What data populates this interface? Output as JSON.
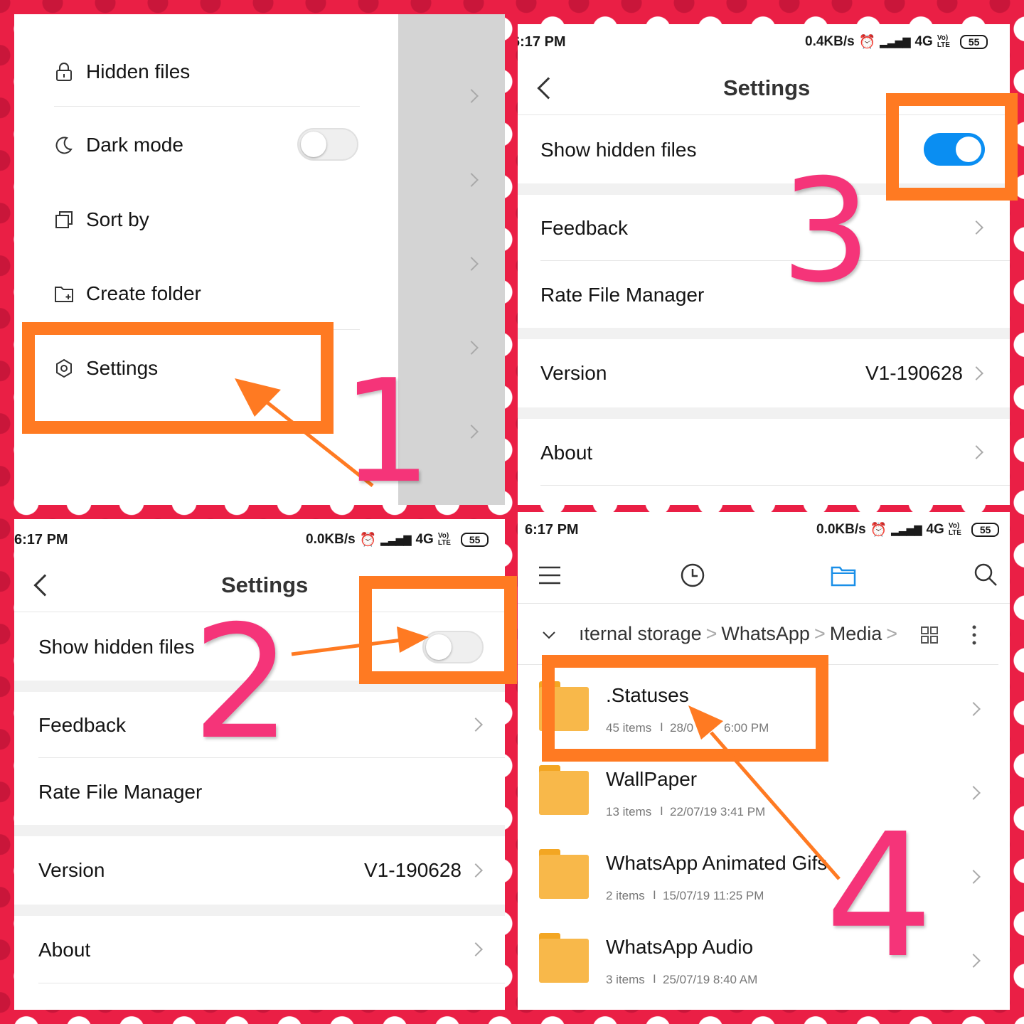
{
  "panel1": {
    "menu": [
      {
        "icon": "lock-icon",
        "label": "Hidden files"
      },
      {
        "icon": "moon-icon",
        "label": "Dark mode"
      },
      {
        "icon": "copy-icon",
        "label": "Sort by"
      },
      {
        "icon": "folder-plus-icon",
        "label": "Create folder"
      },
      {
        "icon": "gear-icon",
        "label": "Settings"
      }
    ],
    "dark_mode_enabled": false,
    "step": "1"
  },
  "panel2": {
    "status": {
      "time": "6:17 PM",
      "speed": "0.0KB/s",
      "network": "4G",
      "volte": "Vo) LTE",
      "battery": "55"
    },
    "title": "Settings",
    "show_hidden_label": "Show hidden files",
    "show_hidden_enabled": false,
    "feedback": "Feedback",
    "rate": "Rate File Manager",
    "version_label": "Version",
    "version_value": "V1-190628",
    "about": "About",
    "step": "2"
  },
  "panel3": {
    "status": {
      "time": "6:17 PM",
      "speed": "0.4KB/s",
      "network": "4G",
      "volte": "Vo) LTE",
      "battery": "55"
    },
    "title": "Settings",
    "show_hidden_label": "Show hidden files",
    "show_hidden_enabled": true,
    "feedback": "Feedback",
    "rate": "Rate File Manager",
    "version_label": "Version",
    "version_value": "V1-190628",
    "about": "About",
    "step": "3"
  },
  "panel4": {
    "status": {
      "time": "6:17 PM",
      "speed": "0.0KB/s",
      "network": "4G",
      "volte": "Vo) LTE",
      "battery": "55"
    },
    "breadcrumb": [
      "ıternal storage",
      "WhatsApp",
      "Media"
    ],
    "folders": [
      {
        "name": ".Statuses",
        "items": "45 items",
        "date": "28/0",
        "time": "6:00 PM"
      },
      {
        "name": "WallPaper",
        "items": "13 items",
        "date": "22/07/19 3:41 PM"
      },
      {
        "name": "WhatsApp Animated Gifs",
        "items": "2 items",
        "date": "15/07/19 11:25 PM"
      },
      {
        "name": "WhatsApp Audio",
        "items": "3 items",
        "date": "25/07/19 8:40 AM"
      }
    ],
    "meta_separator": "I",
    "step": "4"
  },
  "colors": {
    "highlight": "#ff7a22",
    "step_number": "#f53479",
    "toggle_on": "#0a8ef2",
    "background": "#ea1f45"
  }
}
